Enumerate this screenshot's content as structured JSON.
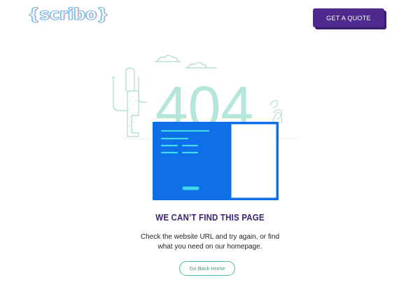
{
  "header": {
    "logo_text": "{scribo}",
    "cta_label": "GET A QUOTE"
  },
  "illustration": {
    "error_code": "404"
  },
  "main": {
    "title": "WE CAN’T FIND THIS PAGE",
    "description_line1": "Check the website URL and try again, or find",
    "description_line2": "what you need on our homepage.",
    "home_button_label": "Go Back Home"
  },
  "colors": {
    "brand_purple": "#4e2a8e",
    "title_purple": "#3d2270",
    "browser_blue": "#0f6fe8",
    "teal_accent": "#4fb7a8",
    "mint_404": "#b5e6dc"
  }
}
